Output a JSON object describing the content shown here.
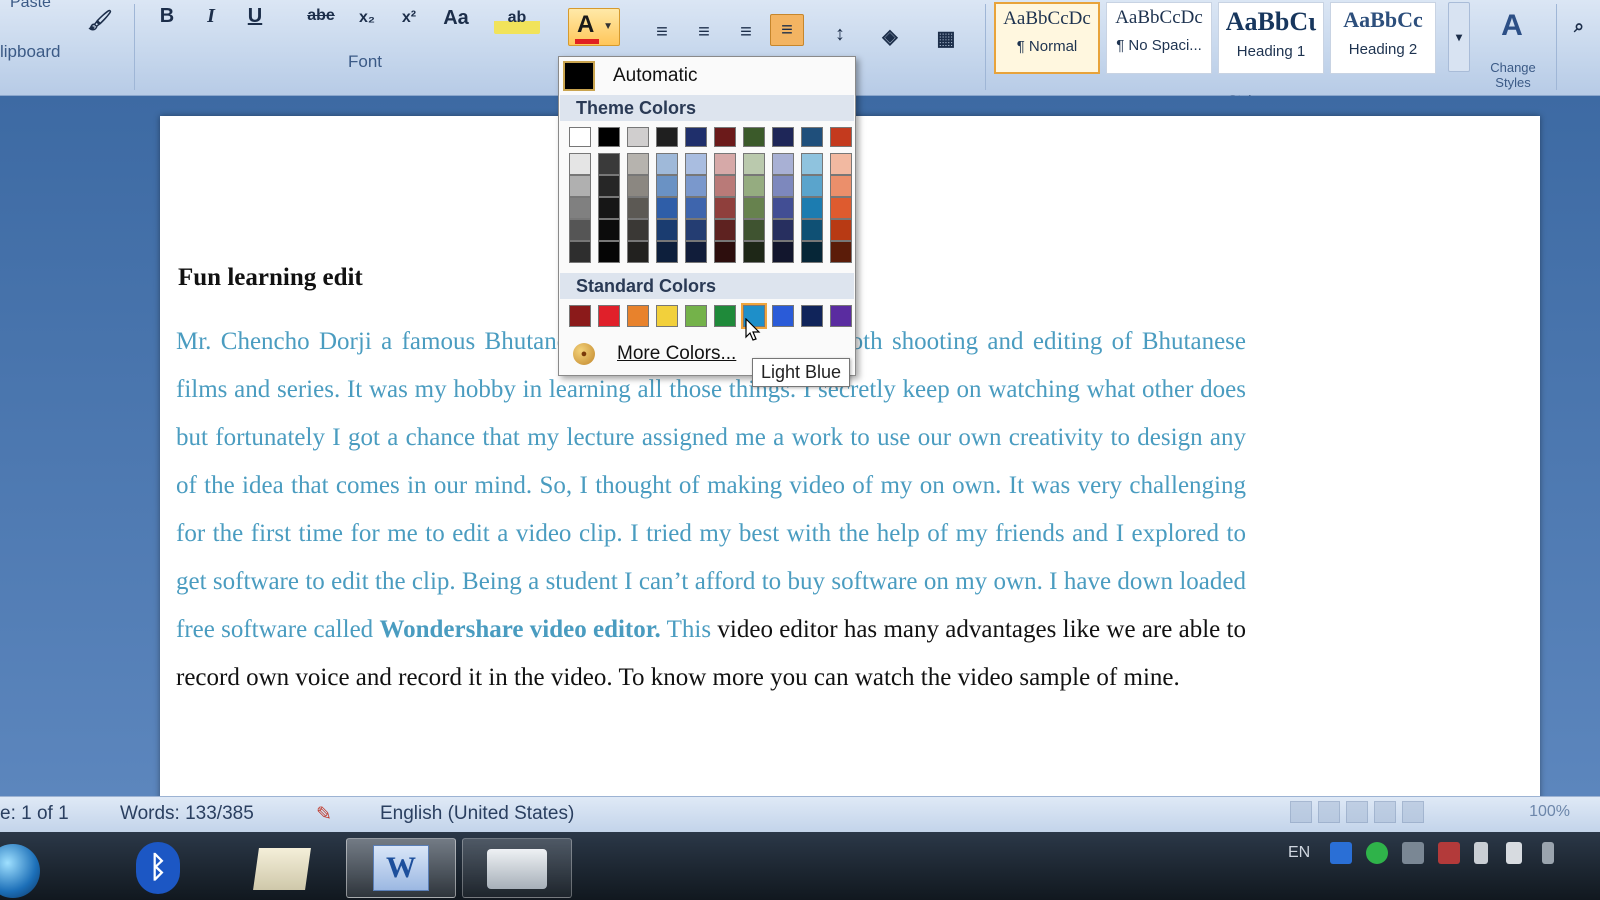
{
  "ribbon": {
    "paste_label": "Paste",
    "clipboard_label": "lipboard",
    "font_group_label": "Font",
    "styles_group_label": "Styles",
    "font_buttons": {
      "bold": "B",
      "italic": "I",
      "underline": "U",
      "strike": "abe",
      "subscript": "x₂",
      "superscript": "x²",
      "change_case": "Aa",
      "highlight": "ab",
      "font_color": "A"
    },
    "styles": [
      {
        "sample": "AaBbCcDc",
        "name": "¶ Normal",
        "active": true
      },
      {
        "sample": "AaBbCcDc",
        "name": "¶ No Spaci...",
        "active": false
      },
      {
        "sample": "AaBbCι",
        "name": "Heading 1",
        "active": false
      },
      {
        "sample": "AaBbCc",
        "name": "Heading 2",
        "active": false
      }
    ],
    "change_styles_label": "Change Styles"
  },
  "color_menu": {
    "automatic_label": "Automatic",
    "theme_header": "Theme Colors",
    "standard_header": "Standard Colors",
    "more_colors_label": "More Colors...",
    "tooltip": "Light Blue",
    "theme_top": [
      "#ffffff",
      "#000000",
      "#d0cece",
      "#1f1f1f",
      "#1f2f6b",
      "#6b1a1a",
      "#3b5a2a",
      "#1e2658",
      "#1f4f7b",
      "#c43a1e"
    ],
    "theme_columns": [
      [
        "#e5e5e5",
        "#b0b0b0",
        "#808080",
        "#555555",
        "#2e2e2e"
      ],
      [
        "#3a3a3a",
        "#262626",
        "#161616",
        "#0c0c0c",
        "#050505"
      ],
      [
        "#b6b3ae",
        "#8b8781",
        "#5c5954",
        "#3a3835",
        "#22211f"
      ],
      [
        "#9fb9d9",
        "#6a92c4",
        "#2f5ea8",
        "#1a3c70",
        "#0d1f3c"
      ],
      [
        "#a9bde0",
        "#7a98cc",
        "#3e65ad",
        "#243d72",
        "#111d3a"
      ],
      [
        "#d6a9a8",
        "#b97a78",
        "#8f3f3c",
        "#5e2220",
        "#2d0e0d"
      ],
      [
        "#bac9ad",
        "#95ac80",
        "#67824e",
        "#3f5330",
        "#1e2717"
      ],
      [
        "#a8b0d4",
        "#7d88bd",
        "#424e94",
        "#272f5f",
        "#12162d"
      ],
      [
        "#8fc3de",
        "#5aa4cc",
        "#1c7cb0",
        "#0f5074",
        "#062637"
      ],
      [
        "#f2b9a1",
        "#eb8f6b",
        "#de5b2f",
        "#b83a14",
        "#5b1c09"
      ]
    ],
    "standard_colors": [
      "#8b1a1a",
      "#e0202a",
      "#e8822c",
      "#f2d03b",
      "#74b24a",
      "#1f8a3a",
      "#1e8fc9",
      "#2a5bd8",
      "#10245a",
      "#5a2ca0"
    ],
    "hover_index": 6
  },
  "document": {
    "title": "Fun learning edit",
    "body_colored": "Mr. Chencho Dorji a famous Bhutanese film camera man does both shooting and editing of Bhutanese films and series. It was my hobby in learning all those things. I secretly keep on watching what other does but fortunately I got a chance that my lecture assigned me a work to use our own creativity to design any of the idea that comes in our mind. So, I thought of making video of my on own. It was very challenging for the first time for me to edit a video clip. I tried my best with the help of my friends and I explored to get software to edit the clip. Being a student I can’t afford to buy software on my own. I have down loaded free software called",
    "body_bold": "Wondershare video editor.",
    "body_this": "This",
    "body_plain": "video editor has many advantages like we are able to record own voice and record it in the video. To know more you can watch the video sample of mine."
  },
  "status": {
    "page": "e: 1 of 1",
    "words": "Words: 133/385",
    "language": "English (United States)",
    "zoom": "100%"
  },
  "taskbar": {
    "language_indicator": "EN",
    "word_icon_text": "W"
  }
}
